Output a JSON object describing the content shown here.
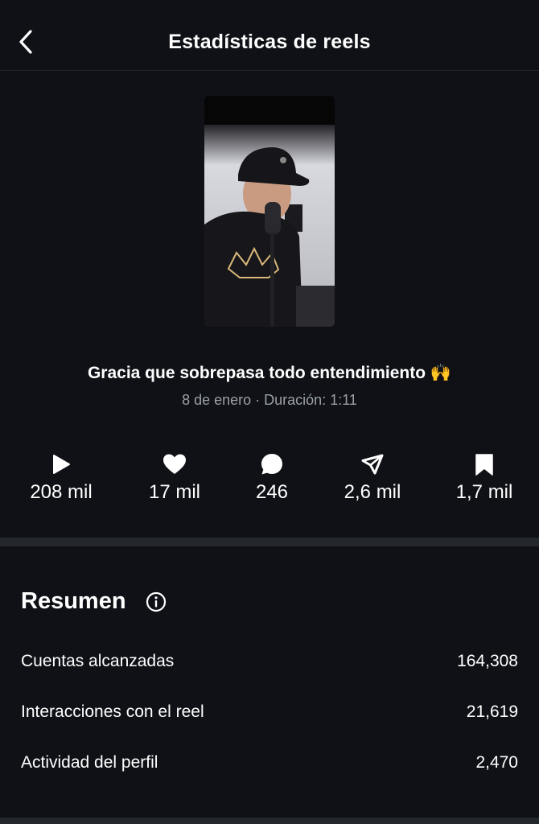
{
  "header": {
    "title": "Estadísticas de reels",
    "back_icon": "chevron-left-icon"
  },
  "reel": {
    "title": "Gracia que sobrepasa todo entendimiento 🙌",
    "meta": "8 de enero · Duración: 1:11"
  },
  "stats": [
    {
      "icon": "play-icon",
      "value": "208 mil"
    },
    {
      "icon": "heart-icon",
      "value": "17 mil"
    },
    {
      "icon": "comment-icon",
      "value": "246"
    },
    {
      "icon": "share-icon",
      "value": "2,6 mil"
    },
    {
      "icon": "bookmark-icon",
      "value": "1,7 mil"
    }
  ],
  "summary": {
    "title": "Resumen",
    "info_icon": "info-icon",
    "rows": [
      {
        "label": "Cuentas alcanzadas",
        "value": "164,308"
      },
      {
        "label": "Interacciones con el reel",
        "value": "21,619"
      },
      {
        "label": "Actividad del perfil",
        "value": "2,470"
      }
    ]
  },
  "colors": {
    "background": "#0f1116",
    "secondary_text": "#9aa0a8",
    "divider": "#24272e"
  }
}
